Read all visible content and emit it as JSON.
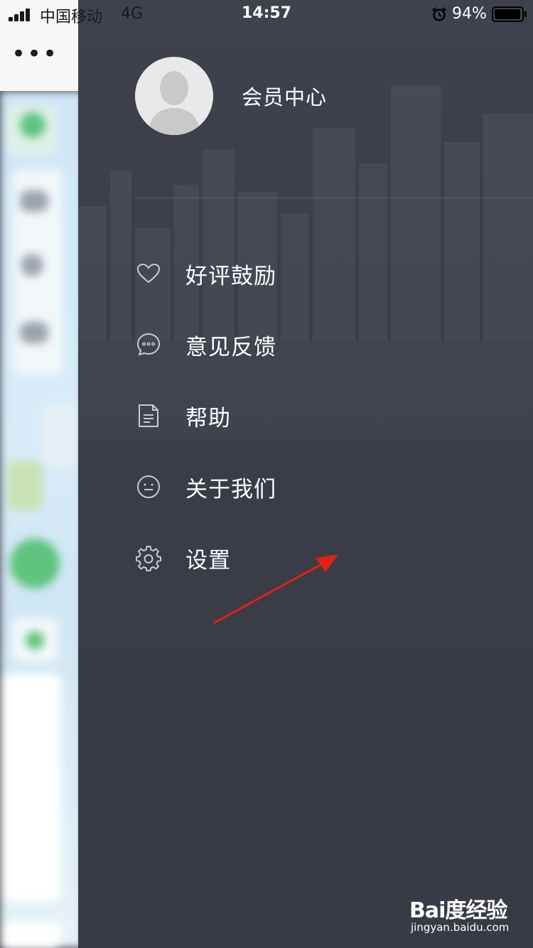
{
  "status_bar": {
    "carrier": "中国移动",
    "network": "4G",
    "time": "14:57",
    "battery": "94%",
    "alarm_icon": "alarm-clock-icon",
    "signal_icon": "signal-bars-icon",
    "battery_icon": "battery-icon"
  },
  "background_app": {
    "more_label": "•••"
  },
  "profile": {
    "avatar_icon": "default-avatar-icon",
    "member_center_label": "会员中心"
  },
  "menu": {
    "items": [
      {
        "label": "好评鼓励",
        "icon": "heart-icon"
      },
      {
        "label": "意见反馈",
        "icon": "chat-bubble-icon"
      },
      {
        "label": "帮助",
        "icon": "document-icon"
      },
      {
        "label": "关于我们",
        "icon": "smiley-icon"
      },
      {
        "label": "设置",
        "icon": "gear-icon"
      }
    ]
  },
  "watermark": {
    "logo": "Bai度经验",
    "url": "jingyan.baidu.com"
  },
  "colors": {
    "drawer_bg": "#3b3e48",
    "text": "#ffffff",
    "icon_stroke": "#c9cbd1",
    "annotation": "#e0201b"
  }
}
